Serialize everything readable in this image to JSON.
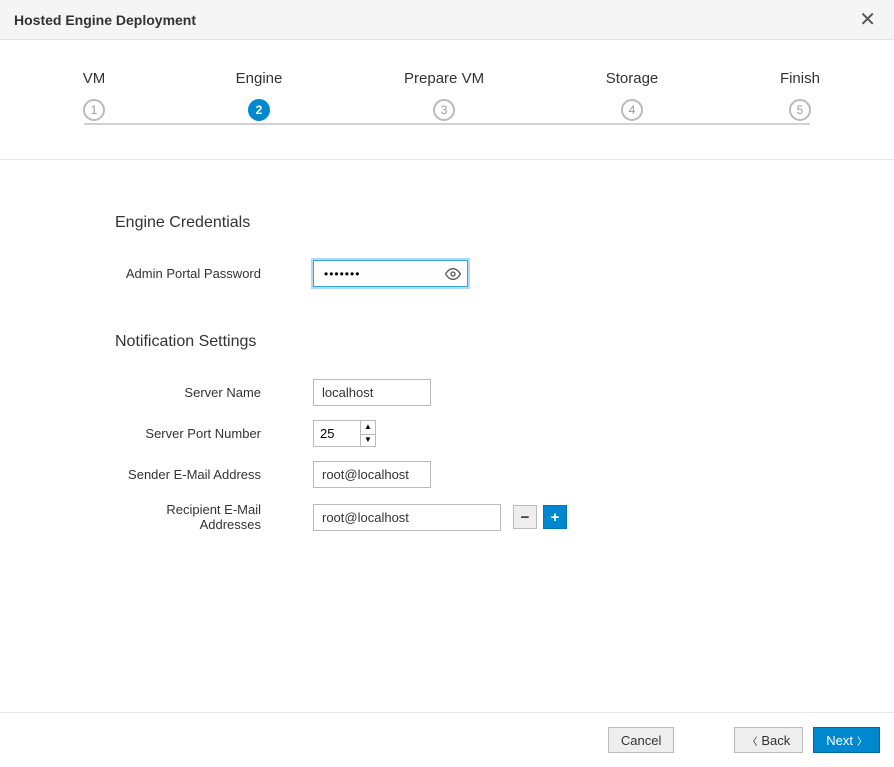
{
  "header": {
    "title": "Hosted Engine Deployment"
  },
  "steps": [
    {
      "num": "1",
      "label": "VM"
    },
    {
      "num": "2",
      "label": "Engine"
    },
    {
      "num": "3",
      "label": "Prepare VM"
    },
    {
      "num": "4",
      "label": "Storage"
    },
    {
      "num": "5",
      "label": "Finish"
    }
  ],
  "section1": {
    "heading": "Engine Credentials",
    "password_label": "Admin Portal Password",
    "password_value": "•••••••"
  },
  "section2": {
    "heading": "Notification Settings",
    "server_name_label": "Server Name",
    "server_name_value": "localhost",
    "server_port_label": "Server Port Number",
    "server_port_value": "25",
    "sender_label": "Sender E-Mail Address",
    "sender_value": "root@localhost",
    "recipient_label": "Recipient E-Mail Addresses",
    "recipient_value": "root@localhost"
  },
  "footer": {
    "cancel": "Cancel",
    "back": "Back",
    "next": "Next"
  }
}
